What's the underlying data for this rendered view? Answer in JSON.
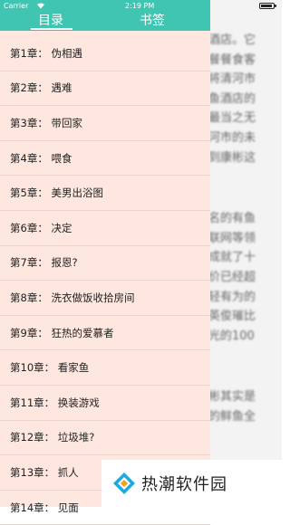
{
  "status_bar": {
    "carrier": "Carrier",
    "time": "2:19 PM"
  },
  "drawer": {
    "tabs": [
      {
        "label": "目录",
        "active": true
      },
      {
        "label": "书签",
        "active": false
      }
    ],
    "chapters": [
      "第1章：  伪相遇",
      "第2章：  遇难",
      "第3章：  带回家",
      "第4章：  喂食",
      "第5章：  美男出浴图",
      "第6章：  决定",
      "第7章：  报恩?",
      "第8章：  洗衣做饭收拾房间",
      "第9章：  狂热的爱慕者",
      "第10章：  看家鱼",
      "第11章：  换装游戏",
      "第12章：  垃圾堆?",
      "第13章：  抓人",
      "第14章：  见面"
    ]
  },
  "reader": {
    "lines_top": [
      "酒店。它",
      "餐餐食客",
      "将清河市",
      "鱼酒店的",
      "最当之无",
      "河市的未",
      "到康彬这"
    ],
    "lines_mid": [
      "名的有鱼",
      "联网等领",
      "成就了十",
      "价已经超",
      "轻有为的",
      "英俊璀比",
      "光的100"
    ],
    "lines_bottom": [
      "彬其实是",
      "的鲜鱼全"
    ]
  },
  "watermark": {
    "text": "热潮软件园"
  },
  "colors": {
    "header": "#3fc5b2",
    "drawer_bg": "#fde7df"
  }
}
